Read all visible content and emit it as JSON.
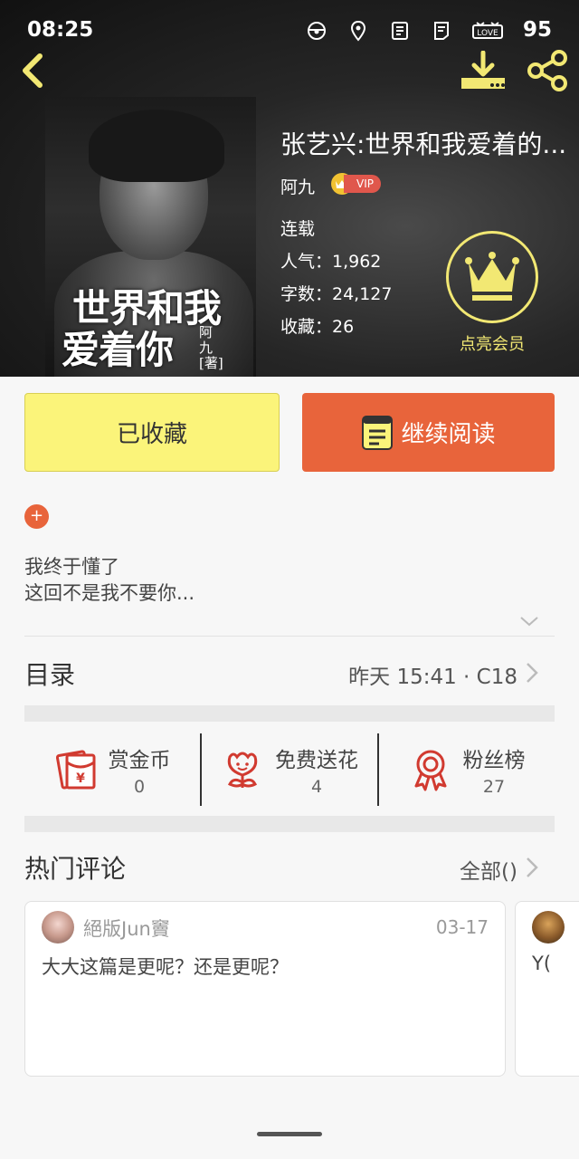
{
  "status_bar": {
    "time": "08:25",
    "battery": "95"
  },
  "book": {
    "title": "张艺兴:世界和我爱着的...",
    "author": "阿九",
    "vip_label": "VIP",
    "status": "连载",
    "popularity": "人气：1,962",
    "word_count": "字数：24,127",
    "collections": "收藏：26",
    "cover": {
      "title_line1": "世界和我",
      "title_line2": "爱着你",
      "author": "阿九[著]"
    }
  },
  "member": {
    "label": "点亮会员"
  },
  "actions": {
    "collected_label": "已收藏",
    "continue_label": "继续阅读"
  },
  "intro": {
    "add_tag": "+",
    "line1": "我终于懂了",
    "line2": "这回不是我不要你..."
  },
  "toc": {
    "title": "目录",
    "update": "昨天 15:41 · C18"
  },
  "stats": [
    {
      "label": "赏金币",
      "value": "0",
      "icon": "red-envelope-icon"
    },
    {
      "label": "免费送花",
      "value": "4",
      "icon": "flower-icon"
    },
    {
      "label": "粉丝榜",
      "value": "27",
      "icon": "medal-icon"
    }
  ],
  "hot_comments": {
    "title": "热门评论",
    "all_label": "全部()",
    "items": [
      {
        "user": "絕版Jun竇",
        "date": "03-17",
        "text": "大大这篇是更呢？还是更呢？"
      },
      {
        "user": "",
        "date": "",
        "text": "Y("
      }
    ]
  },
  "colors": {
    "accent_orange": "#e8643b",
    "collected_yellow": "#fbf47a",
    "gold": "#f2e873"
  }
}
